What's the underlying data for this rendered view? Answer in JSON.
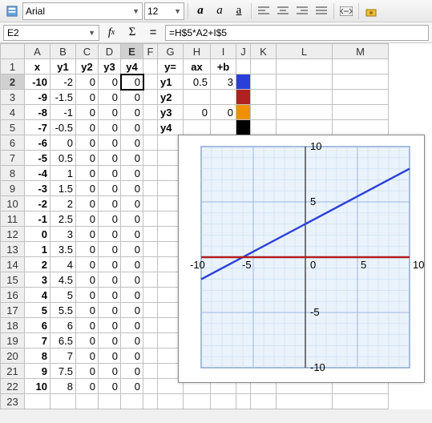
{
  "toolbar": {
    "font": "Arial",
    "size": "12"
  },
  "formula_bar": {
    "cell_ref": "E2",
    "formula": "=H$5*A2+I$5"
  },
  "columns": [
    "A",
    "B",
    "C",
    "D",
    "E",
    "F",
    "G",
    "H",
    "I",
    "J",
    "K",
    "L",
    "M"
  ],
  "row_headers": [
    "x",
    "y1",
    "y2",
    "y3",
    "y4",
    "",
    "y=",
    "ax",
    "+b"
  ],
  "side_labels": [
    "y1",
    "y2",
    "y3",
    "y4"
  ],
  "side_ax": [
    "0.5",
    "",
    "0",
    ""
  ],
  "side_b": [
    "3",
    "",
    "0",
    ""
  ],
  "swatch_colors": [
    "#2a3fd9",
    "#b02020",
    "#f09000",
    "#000000"
  ],
  "data_rows": [
    {
      "x": "-10",
      "y1": "-2",
      "y2": "0",
      "y3": "0",
      "y4": "0"
    },
    {
      "x": "-9",
      "y1": "-1.5",
      "y2": "0",
      "y3": "0",
      "y4": "0"
    },
    {
      "x": "-8",
      "y1": "-1",
      "y2": "0",
      "y3": "0",
      "y4": "0"
    },
    {
      "x": "-7",
      "y1": "-0.5",
      "y2": "0",
      "y3": "0",
      "y4": "0"
    },
    {
      "x": "-6",
      "y1": "0",
      "y2": "0",
      "y3": "0",
      "y4": "0"
    },
    {
      "x": "-5",
      "y1": "0.5",
      "y2": "0",
      "y3": "0",
      "y4": "0"
    },
    {
      "x": "-4",
      "y1": "1",
      "y2": "0",
      "y3": "0",
      "y4": "0"
    },
    {
      "x": "-3",
      "y1": "1.5",
      "y2": "0",
      "y3": "0",
      "y4": "0"
    },
    {
      "x": "-2",
      "y1": "2",
      "y2": "0",
      "y3": "0",
      "y4": "0"
    },
    {
      "x": "-1",
      "y1": "2.5",
      "y2": "0",
      "y3": "0",
      "y4": "0"
    },
    {
      "x": "0",
      "y1": "3",
      "y2": "0",
      "y3": "0",
      "y4": "0"
    },
    {
      "x": "1",
      "y1": "3.5",
      "y2": "0",
      "y3": "0",
      "y4": "0"
    },
    {
      "x": "2",
      "y1": "4",
      "y2": "0",
      "y3": "0",
      "y4": "0"
    },
    {
      "x": "3",
      "y1": "4.5",
      "y2": "0",
      "y3": "0",
      "y4": "0"
    },
    {
      "x": "4",
      "y1": "5",
      "y2": "0",
      "y3": "0",
      "y4": "0"
    },
    {
      "x": "5",
      "y1": "5.5",
      "y2": "0",
      "y3": "0",
      "y4": "0"
    },
    {
      "x": "6",
      "y1": "6",
      "y2": "0",
      "y3": "0",
      "y4": "0"
    },
    {
      "x": "7",
      "y1": "6.5",
      "y2": "0",
      "y3": "0",
      "y4": "0"
    },
    {
      "x": "8",
      "y1": "7",
      "y2": "0",
      "y3": "0",
      "y4": "0"
    },
    {
      "x": "9",
      "y1": "7.5",
      "y2": "0",
      "y3": "0",
      "y4": "0"
    },
    {
      "x": "10",
      "y1": "8",
      "y2": "0",
      "y3": "0",
      "y4": "0"
    }
  ],
  "chart_data": {
    "type": "line",
    "xlim": [
      -10,
      10
    ],
    "ylim": [
      -10,
      10
    ],
    "xticks": [
      -10,
      -5,
      0,
      5,
      10
    ],
    "yticks": [
      -10,
      -5,
      0,
      5,
      10
    ],
    "series": [
      {
        "name": "y1",
        "color": "#2a3fd9",
        "points": [
          [
            -10,
            -2
          ],
          [
            10,
            8
          ]
        ]
      },
      {
        "name": "y2",
        "color": "#b02020",
        "points": [
          [
            -10,
            0
          ],
          [
            10,
            0
          ]
        ]
      }
    ]
  }
}
